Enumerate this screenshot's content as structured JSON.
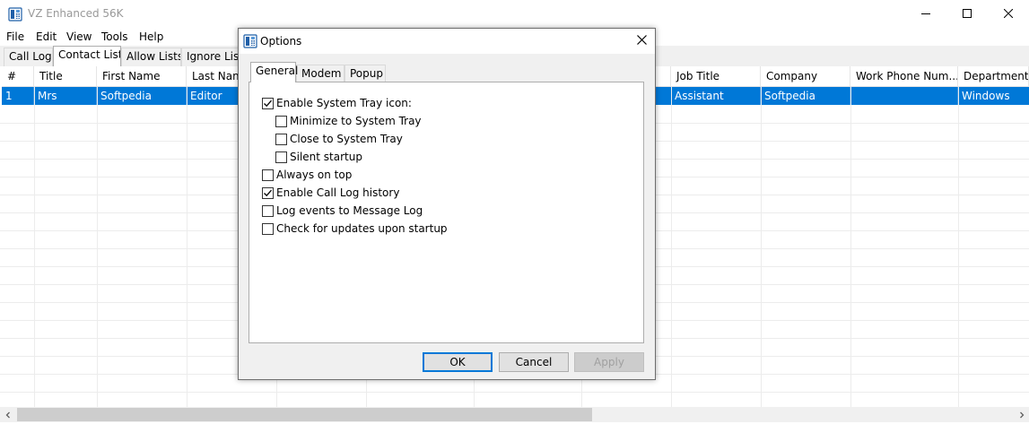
{
  "app": {
    "title": "VZ Enhanced 56K"
  },
  "menu": [
    "File",
    "Edit",
    "View",
    "Tools",
    "Help"
  ],
  "main_tabs": [
    "Call Log",
    "Contact List",
    "Allow Lists",
    "Ignore Lists"
  ],
  "active_main_tab": "Contact List",
  "grid": {
    "columns": [
      "#",
      "Title",
      "First Name",
      "Last Name",
      "Job Title",
      "Company",
      "Work Phone Num...",
      "Department"
    ],
    "selected_row": [
      "1",
      "Mrs",
      "Softpedia",
      "Editor",
      "Assistant",
      "Softpedia",
      "",
      "Windows"
    ]
  },
  "dialog": {
    "title": "Options",
    "tabs": [
      "General",
      "Modem",
      "Popup"
    ],
    "active_tab": "General",
    "options": [
      {
        "label": "Enable System Tray icon:",
        "checked": true
      },
      {
        "label": "Minimize to System Tray",
        "checked": false
      },
      {
        "label": "Close to System Tray",
        "checked": false
      },
      {
        "label": "Silent startup",
        "checked": false
      },
      {
        "label": "Always on top",
        "checked": false
      },
      {
        "label": "Enable Call Log history",
        "checked": true
      },
      {
        "label": "Log events to Message Log",
        "checked": false
      },
      {
        "label": "Check for updates upon startup",
        "checked": false
      }
    ],
    "buttons": {
      "ok": "OK",
      "cancel": "Cancel",
      "apply": "Apply"
    }
  },
  "icons": {
    "app": "phone-icon",
    "minimize": "minimize-icon",
    "maximize": "maximize-icon",
    "close": "close-icon",
    "checkmark": "checkmark-icon",
    "scroll_left": "chevron-left-icon",
    "scroll_right": "chevron-right-icon"
  },
  "colors": {
    "selection": "#0078d7",
    "dialog_background": "#f0f0f0",
    "default_button_border": "#0078d7"
  }
}
